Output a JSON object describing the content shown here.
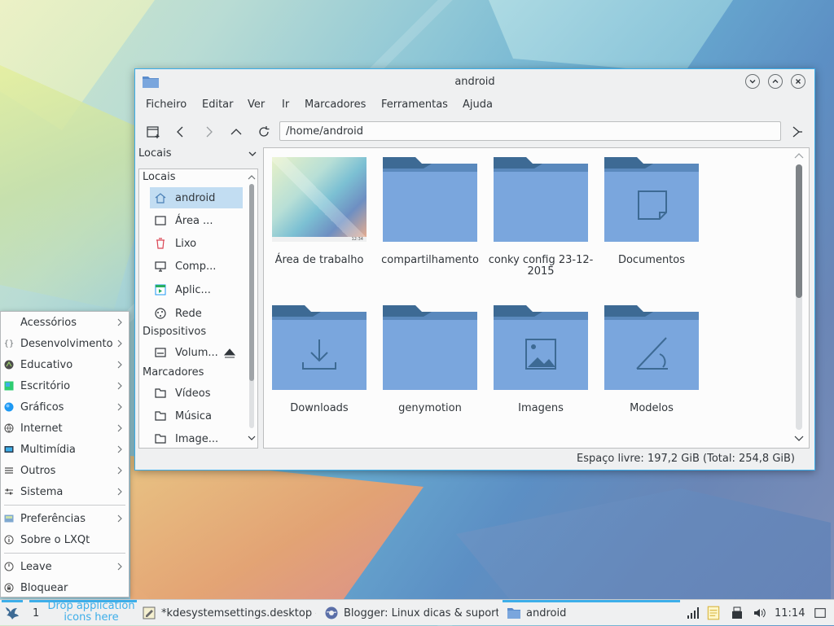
{
  "window": {
    "title": "android",
    "menu": [
      "Ficheiro",
      "Editar",
      "Ver",
      "Ir",
      "Marcadores",
      "Ferramentas",
      "Ajuda"
    ],
    "path": "/home/android",
    "side_header": "Locais",
    "side": {
      "sec_places": "Locais",
      "places": [
        "android",
        "Área ...",
        "Lixo",
        "Comp...",
        "Aplic...",
        "Rede"
      ],
      "sec_devices": "Dispositivos",
      "devices": [
        "Volum..."
      ],
      "sec_bookmarks": "Marcadores",
      "bookmarks": [
        "Vídeos",
        "Música",
        "Image..."
      ]
    },
    "items": [
      {
        "label": "Área de trabalho",
        "kind": "thumbnail",
        "thumb_clock": "12:34"
      },
      {
        "label": "compartilhamento",
        "kind": "folder"
      },
      {
        "label": "conky config 23-12-2015",
        "kind": "folder"
      },
      {
        "label": "Documentos",
        "kind": "folder-documents"
      },
      {
        "label": "Downloads",
        "kind": "folder-downloads"
      },
      {
        "label": "genymotion",
        "kind": "folder"
      },
      {
        "label": "Imagens",
        "kind": "folder-pictures"
      },
      {
        "label": "Modelos",
        "kind": "folder-templates"
      }
    ],
    "status": "Espaço livre: 197,2 GiB (Total: 254,8 GiB)"
  },
  "appmenu": {
    "items": [
      "Acessórios",
      "Desenvolvimento",
      "Educativo",
      "Escritório",
      "Gráficos",
      "Internet",
      "Multimídia",
      "Outros",
      "Sistema"
    ],
    "prefs": [
      "Preferências",
      "Sobre o LXQt"
    ],
    "session": [
      "Leave",
      "Bloquear"
    ]
  },
  "taskbar": {
    "desktop_num": "1",
    "quicklaunch_hint": "Drop application icons here",
    "tasks": [
      "*kdesystemsettings.desktop -",
      "Blogger: Linux dicas & suporte",
      "android"
    ],
    "clock": "11:14"
  },
  "colors": {
    "accent": "#3daee9",
    "folder_main": "#7aa6dd",
    "folder_dark": "#3d6a94",
    "selection": "#c2ddf2"
  }
}
